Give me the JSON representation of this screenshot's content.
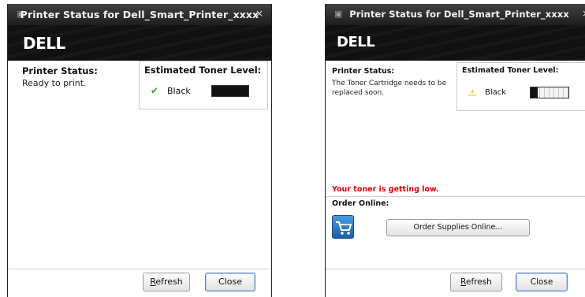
{
  "left_window": {
    "title": "Printer Status for Dell_Smart_Printer_xxxx",
    "close_glyph": "×",
    "logo": "DELL",
    "printer_status_label": "Printer Status:",
    "printer_status_text": "Ready to print.",
    "toner": {
      "title": "Estimated Toner Level:",
      "status_icon": "check-icon",
      "color_name": "Black",
      "level_fraction": 1.0
    },
    "buttons": {
      "refresh": "Refresh",
      "close": "Close"
    }
  },
  "right_window": {
    "title": "Printer Status for Dell_Smart_Printer_xxxx",
    "close_glyph": "×",
    "logo": "DELL",
    "printer_status_label": "Printer Status:",
    "printer_status_text": "The Toner Cartridge needs to be replaced soon.",
    "toner": {
      "title": "Estimated Toner Level:",
      "status_icon": "warning-icon",
      "color_name": "Black",
      "level_fraction": 0.18
    },
    "warning_message": "Your toner is getting low.",
    "order_online_label": "Order Online:",
    "order_supplies_button": "Order Supplies Online...",
    "buttons": {
      "refresh": "Refresh",
      "close": "Close"
    }
  },
  "colors": {
    "titlebar": "#2b2b2b",
    "warning_text": "#e00000",
    "check": "#3a9a2a",
    "warning_icon": "#e8b800",
    "cart_icon": "#2a78c8"
  }
}
